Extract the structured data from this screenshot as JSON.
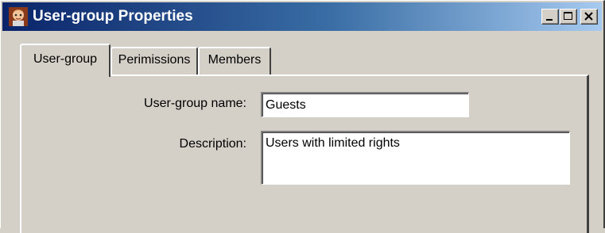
{
  "window": {
    "title": "User-group Properties",
    "app_icon": "user-group-icon",
    "buttons": {
      "minimize": "minimize-icon",
      "maximize": "maximize-icon",
      "close": "close-icon"
    }
  },
  "tabs": [
    {
      "label": "User-group",
      "active": true
    },
    {
      "label": "Perimissions",
      "active": false
    },
    {
      "label": "Members",
      "active": false
    }
  ],
  "form": {
    "name_label": "User-group name:",
    "name_value": "Guests",
    "description_label": "Description:",
    "description_value": "Users with limited rights"
  },
  "colors": {
    "title_gradient_start": "#0a246a",
    "title_gradient_end": "#a6caf0",
    "face": "#d4d0c8"
  }
}
